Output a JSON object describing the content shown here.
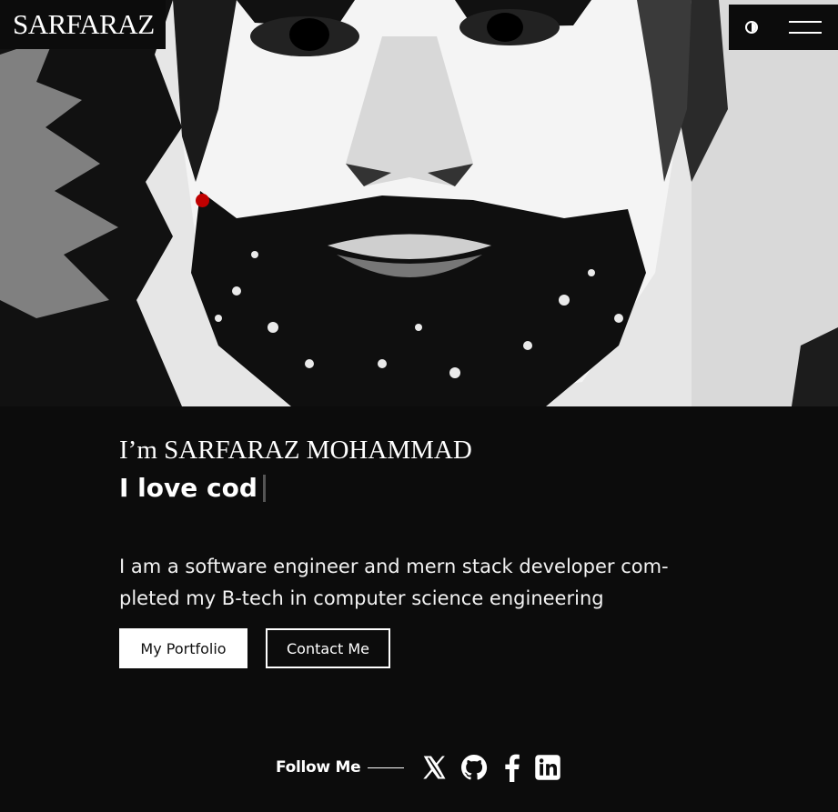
{
  "header": {
    "logo": "SARFARAZ",
    "theme_icon": "contrast-icon",
    "menu_icon": "hamburger-menu-icon"
  },
  "hero": {
    "image": "black-and-white portrait illustration of a bearded man",
    "cursor_color": "#c00000"
  },
  "intro": {
    "greeting": "I’m SARFARAZ MOHAMMAD",
    "typed_text": "I love cod",
    "bio": "I am a software engineer and mern stack developer com-pleted my B-tech in computer science engineering"
  },
  "buttons": {
    "portfolio": "My Portfolio",
    "contact": "Contact Me"
  },
  "follow": {
    "label": "Follow Me",
    "icons": [
      "x-twitter-icon",
      "github-icon",
      "facebook-icon",
      "linkedin-icon"
    ]
  },
  "colors": {
    "background": "#0c0c0c",
    "text": "#ffffff",
    "accent": "#c00000"
  }
}
